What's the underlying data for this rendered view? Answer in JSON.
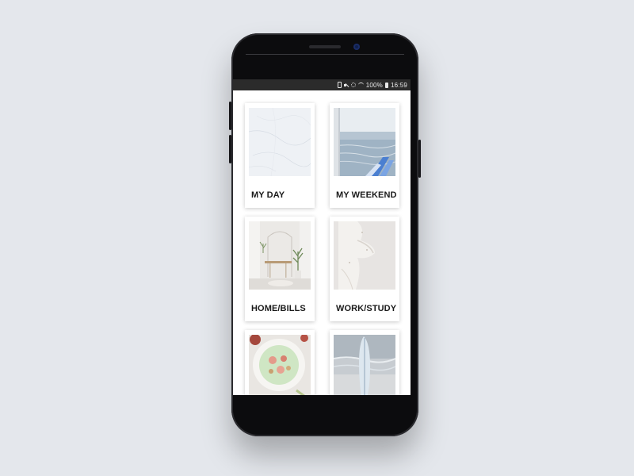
{
  "status_bar": {
    "battery_percent": "100%",
    "time": "16:59",
    "icons": [
      "battery-saver-icon",
      "mute-icon",
      "settings-icon",
      "wifi-icon",
      "battery-icon"
    ]
  },
  "cards": [
    {
      "label": "MY DAY",
      "image": "white-marble-texture"
    },
    {
      "label": "MY WEEKEND",
      "image": "sea-and-beach-chair"
    },
    {
      "label": "HOME/BILLS",
      "image": "bright-home-interior"
    },
    {
      "label": "WORK/STUDY",
      "image": "white-sculpture"
    },
    {
      "label": "",
      "image": "fruit-bowl"
    },
    {
      "label": "",
      "image": "surfboard-on-beach"
    }
  ],
  "colors": {
    "background": "#e4e7ec",
    "phone_body": "#0c0c0e",
    "status_bar": "#2b2b2b",
    "card_text": "#1a1a1a"
  }
}
